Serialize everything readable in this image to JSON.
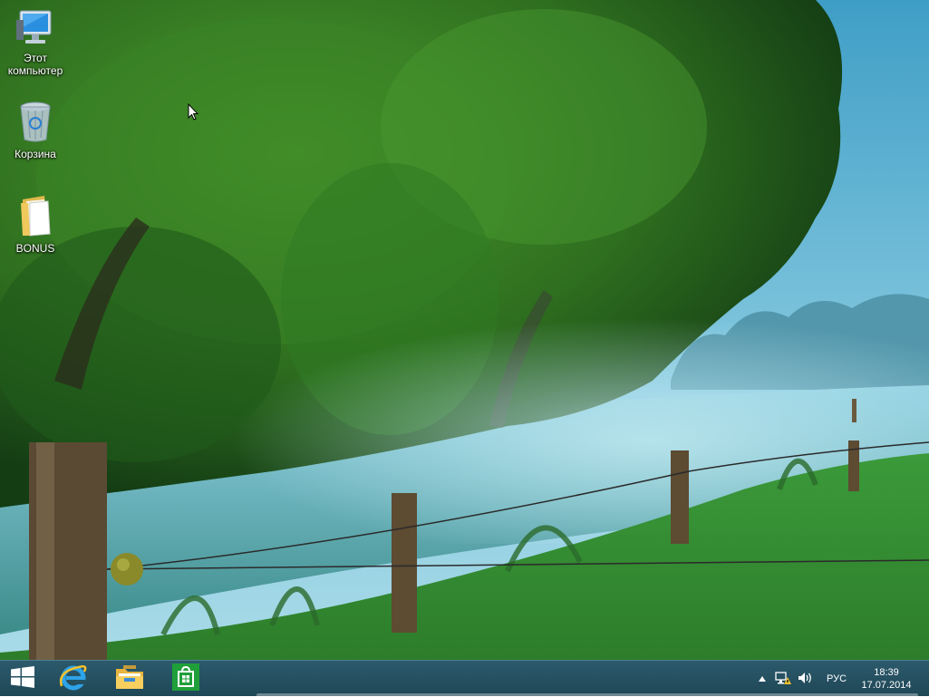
{
  "desktop": {
    "icons": [
      {
        "label": "Этот компьютер",
        "icon": "computer-icon"
      },
      {
        "label": "Корзина",
        "icon": "recycle-bin-icon"
      },
      {
        "label": "BONUS",
        "icon": "folder-icon"
      }
    ]
  },
  "taskbar": {
    "start_icon": "windows-logo-icon",
    "pinned": [
      {
        "name": "Internet Explorer",
        "icon": "internet-explorer-icon"
      },
      {
        "name": "File Explorer",
        "icon": "file-explorer-icon"
      },
      {
        "name": "Store",
        "icon": "store-icon"
      }
    ],
    "tray": {
      "language": "РУС",
      "time": "18:39",
      "date": "17.07.2014"
    }
  },
  "colors": {
    "taskbar": "#24505f",
    "sky": "#4aa6c9",
    "foliage": "#2e7a25",
    "grass": "#3fa040",
    "water": "#6fb6cc"
  }
}
